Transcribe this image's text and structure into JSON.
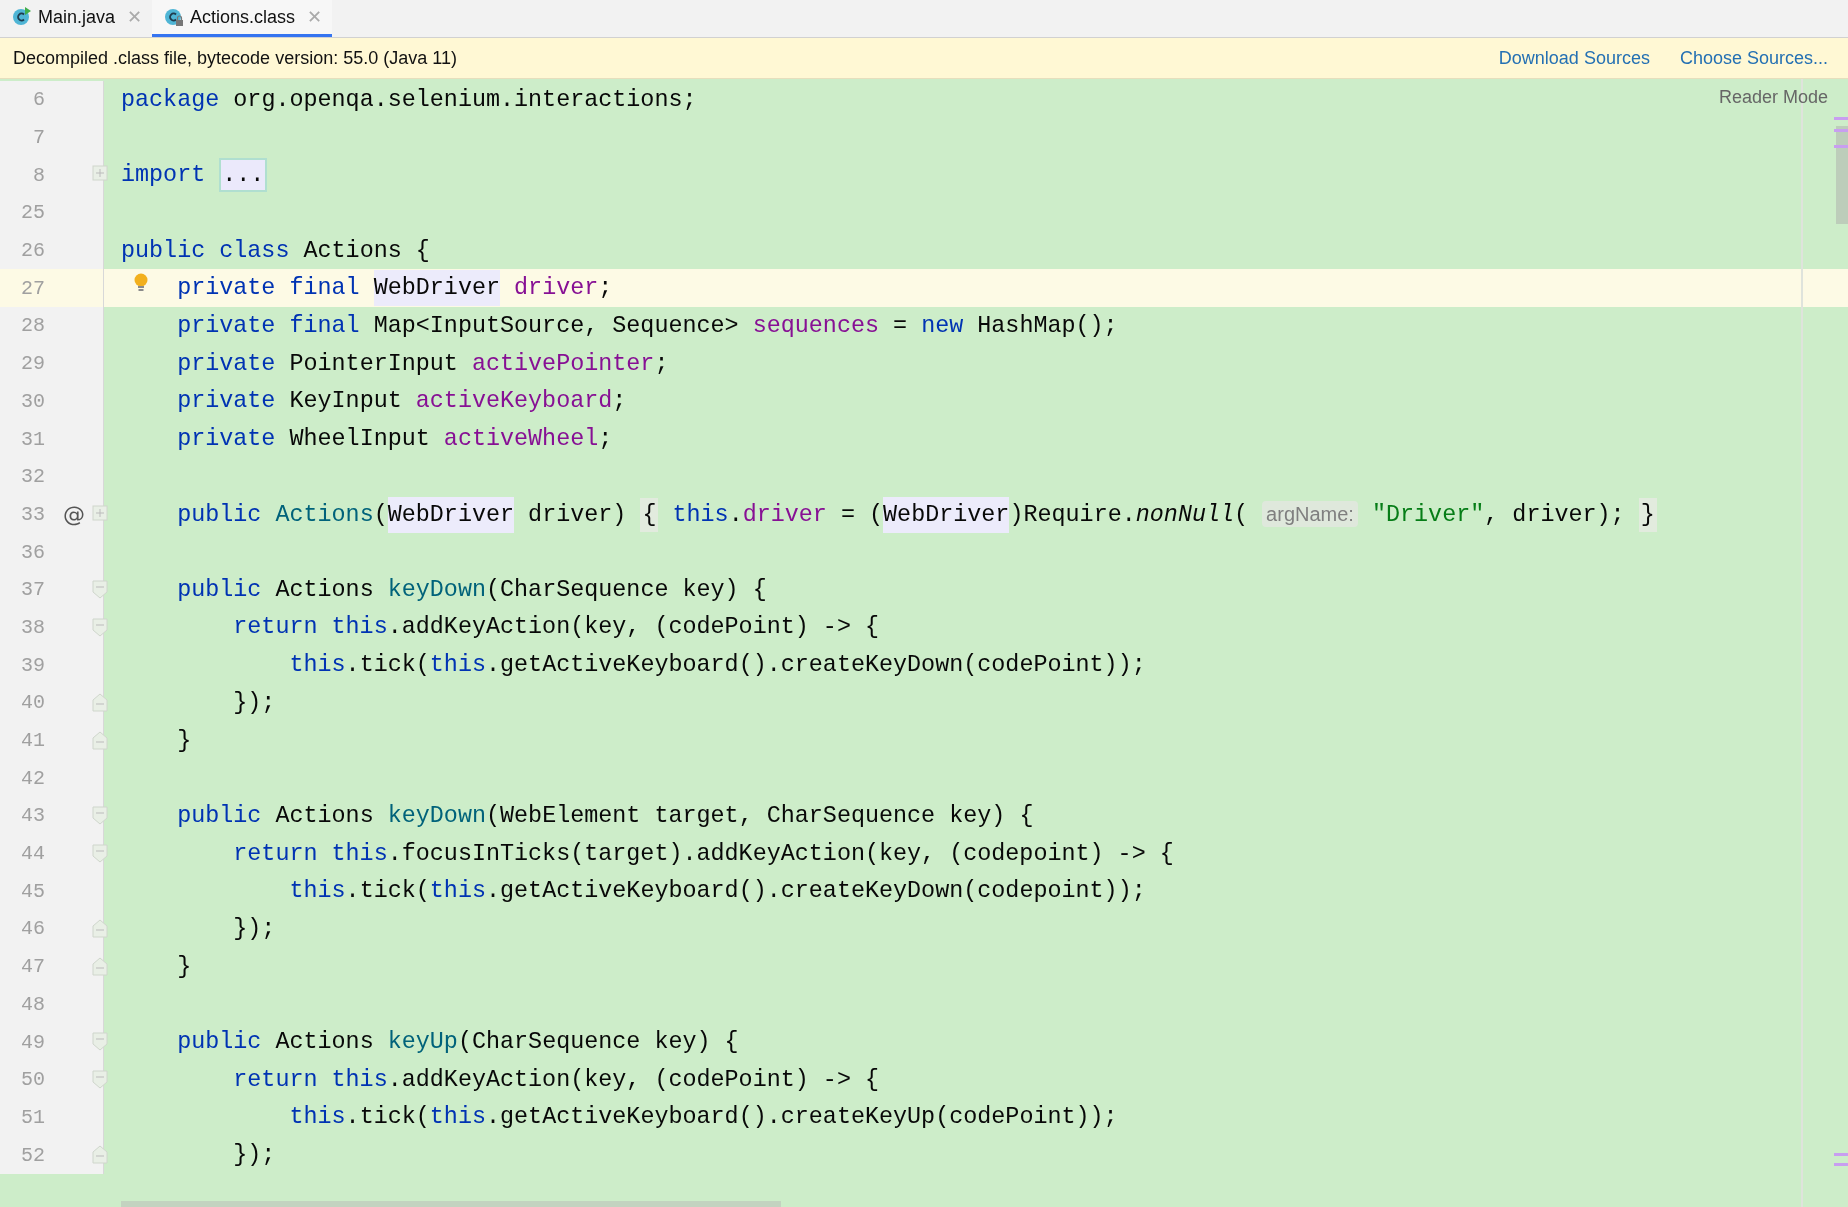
{
  "tabs": [
    {
      "label": "Main.java",
      "close": "✕",
      "selected": false
    },
    {
      "label": "Actions.class",
      "close": "✕",
      "selected": true
    }
  ],
  "banner": {
    "message": "Decompiled .class file, bytecode version: 55.0 (Java 11)",
    "links": [
      "Download Sources",
      "Choose Sources..."
    ]
  },
  "editor": {
    "reader_mode": "Reader Mode",
    "lines": [
      {
        "number": "6",
        "current": false,
        "bulb": false,
        "tokens": [
          {
            "kind": "keyword",
            "text": "package"
          },
          {
            "kind": "plain",
            "text": " org.openqa.selenium.interactions;"
          }
        ]
      },
      {
        "number": "7",
        "current": false,
        "bulb": false
      },
      {
        "number": "8",
        "current": false,
        "bulb": false,
        "fold": {
          "kind": "expand"
        },
        "tokens": [
          {
            "kind": "keyword",
            "text": "import "
          },
          {
            "kind": "folded",
            "text": "..."
          }
        ]
      },
      {
        "number": "25",
        "current": false,
        "bulb": false
      },
      {
        "number": "26",
        "current": false,
        "bulb": false,
        "tokens": [
          {
            "kind": "keyword",
            "text": "public class"
          },
          {
            "kind": "plain",
            "text": " Actions {"
          }
        ]
      },
      {
        "number": "27",
        "current": true,
        "bulb": true,
        "tokens": [
          {
            "kind": "keyword",
            "text": "    private final "
          },
          {
            "kind": "usage",
            "text": "WebDriver"
          },
          {
            "kind": "field",
            "text": " driver"
          },
          {
            "kind": "plain",
            "text": ";"
          }
        ]
      },
      {
        "number": "28",
        "current": false,
        "bulb": false,
        "tokens": [
          {
            "kind": "keyword",
            "text": "    private final"
          },
          {
            "kind": "plain",
            "text": " Map<InputSource, Sequence> "
          },
          {
            "kind": "field",
            "text": "sequences"
          },
          {
            "kind": "plain",
            "text": " = "
          },
          {
            "kind": "keyword",
            "text": "new"
          },
          {
            "kind": "plain",
            "text": " HashMap();"
          }
        ]
      },
      {
        "number": "29",
        "current": false,
        "bulb": false,
        "tokens": [
          {
            "kind": "keyword",
            "text": "    private"
          },
          {
            "kind": "plain",
            "text": " PointerInput "
          },
          {
            "kind": "field",
            "text": "activePointer"
          },
          {
            "kind": "plain",
            "text": ";"
          }
        ]
      },
      {
        "number": "30",
        "current": false,
        "bulb": false,
        "tokens": [
          {
            "kind": "keyword",
            "text": "    private"
          },
          {
            "kind": "plain",
            "text": " KeyInput "
          },
          {
            "kind": "field",
            "text": "activeKeyboard"
          },
          {
            "kind": "plain",
            "text": ";"
          }
        ]
      },
      {
        "number": "31",
        "current": false,
        "bulb": false,
        "tokens": [
          {
            "kind": "keyword",
            "text": "    private"
          },
          {
            "kind": "plain",
            "text": " WheelInput "
          },
          {
            "kind": "field",
            "text": "activeWheel"
          },
          {
            "kind": "plain",
            "text": ";"
          }
        ]
      },
      {
        "number": "32",
        "current": false,
        "bulb": false
      },
      {
        "number": "33",
        "current": false,
        "bulb": false,
        "marker": "@",
        "fold": {
          "kind": "expand"
        },
        "tokens": [
          {
            "kind": "keyword",
            "text": "    public "
          },
          {
            "kind": "method",
            "text": "Actions"
          },
          {
            "kind": "plain",
            "text": "("
          },
          {
            "kind": "usage",
            "text": "WebDriver"
          },
          {
            "kind": "plain",
            "text": " driver) "
          },
          {
            "kind": "brace",
            "text": "{"
          },
          {
            "kind": "keyword",
            "text": " this"
          },
          {
            "kind": "plain",
            "text": "."
          },
          {
            "kind": "field",
            "text": "driver"
          },
          {
            "kind": "plain",
            "text": " = ("
          },
          {
            "kind": "usage",
            "text": "WebDriver"
          },
          {
            "kind": "plain",
            "text": ")Require."
          },
          {
            "kind": "static",
            "text": "nonNull"
          },
          {
            "kind": "plain",
            "text": "( "
          },
          {
            "kind": "hint",
            "text": "argName:"
          },
          {
            "kind": "string",
            "text": " \"Driver\""
          },
          {
            "kind": "plain",
            "text": ", driver); "
          },
          {
            "kind": "brace",
            "text": "}"
          }
        ]
      },
      {
        "number": "36",
        "current": false,
        "bulb": false
      },
      {
        "number": "37",
        "current": false,
        "bulb": false,
        "fold": {
          "kind": "open"
        },
        "tokens": [
          {
            "kind": "keyword",
            "text": "    public"
          },
          {
            "kind": "plain",
            "text": " Actions "
          },
          {
            "kind": "method",
            "text": "keyDown"
          },
          {
            "kind": "plain",
            "text": "(CharSequence key) {"
          }
        ]
      },
      {
        "number": "38",
        "current": false,
        "bulb": false,
        "fold": {
          "kind": "open"
        },
        "tokens": [
          {
            "kind": "keyword",
            "text": "        return this"
          },
          {
            "kind": "plain",
            "text": ".addKeyAction(key, (codePoint) -> {"
          }
        ]
      },
      {
        "number": "39",
        "current": false,
        "bulb": false,
        "tokens": [
          {
            "kind": "keyword",
            "text": "            this"
          },
          {
            "kind": "plain",
            "text": ".tick("
          },
          {
            "kind": "keyword",
            "text": "this"
          },
          {
            "kind": "plain",
            "text": ".getActiveKeyboard().createKeyDown(codePoint));"
          }
        ]
      },
      {
        "number": "40",
        "current": false,
        "bulb": false,
        "fold": {
          "kind": "close"
        },
        "tokens": [
          {
            "kind": "plain",
            "text": "        });"
          }
        ]
      },
      {
        "number": "41",
        "current": false,
        "bulb": false,
        "fold": {
          "kind": "close"
        },
        "tokens": [
          {
            "kind": "plain",
            "text": "    }"
          }
        ]
      },
      {
        "number": "42",
        "current": false,
        "bulb": false
      },
      {
        "number": "43",
        "current": false,
        "bulb": false,
        "fold": {
          "kind": "open"
        },
        "tokens": [
          {
            "kind": "keyword",
            "text": "    public"
          },
          {
            "kind": "plain",
            "text": " Actions "
          },
          {
            "kind": "method",
            "text": "keyDown"
          },
          {
            "kind": "plain",
            "text": "(WebElement target, CharSequence key) {"
          }
        ]
      },
      {
        "number": "44",
        "current": false,
        "bulb": false,
        "fold": {
          "kind": "open"
        },
        "tokens": [
          {
            "kind": "keyword",
            "text": "        return this"
          },
          {
            "kind": "plain",
            "text": ".focusInTicks(target).addKeyAction(key, (codepoint) -> {"
          }
        ]
      },
      {
        "number": "45",
        "current": false,
        "bulb": false,
        "tokens": [
          {
            "kind": "keyword",
            "text": "            this"
          },
          {
            "kind": "plain",
            "text": ".tick("
          },
          {
            "kind": "keyword",
            "text": "this"
          },
          {
            "kind": "plain",
            "text": ".getActiveKeyboard().createKeyDown(codepoint));"
          }
        ]
      },
      {
        "number": "46",
        "current": false,
        "bulb": false,
        "fold": {
          "kind": "close"
        },
        "tokens": [
          {
            "kind": "plain",
            "text": "        });"
          }
        ]
      },
      {
        "number": "47",
        "current": false,
        "bulb": false,
        "fold": {
          "kind": "close"
        },
        "tokens": [
          {
            "kind": "plain",
            "text": "    }"
          }
        ]
      },
      {
        "number": "48",
        "current": false,
        "bulb": false
      },
      {
        "number": "49",
        "current": false,
        "bulb": false,
        "fold": {
          "kind": "open"
        },
        "tokens": [
          {
            "kind": "keyword",
            "text": "    public"
          },
          {
            "kind": "plain",
            "text": " Actions "
          },
          {
            "kind": "method",
            "text": "keyUp"
          },
          {
            "kind": "plain",
            "text": "(CharSequence key) {"
          }
        ]
      },
      {
        "number": "50",
        "current": false,
        "bulb": false,
        "fold": {
          "kind": "open"
        },
        "tokens": [
          {
            "kind": "keyword",
            "text": "        return this"
          },
          {
            "kind": "plain",
            "text": ".addKeyAction(key, (codePoint) -> {"
          }
        ]
      },
      {
        "number": "51",
        "current": false,
        "bulb": false,
        "tokens": [
          {
            "kind": "keyword",
            "text": "            this"
          },
          {
            "kind": "plain",
            "text": ".tick("
          },
          {
            "kind": "keyword",
            "text": "this"
          },
          {
            "kind": "plain",
            "text": ".getActiveKeyboard().createKeyUp(codePoint));"
          }
        ]
      },
      {
        "number": "52",
        "current": false,
        "bulb": false,
        "fold": {
          "kind": "close"
        },
        "tokens": [
          {
            "kind": "plain",
            "text": "        });"
          }
        ]
      }
    ]
  }
}
